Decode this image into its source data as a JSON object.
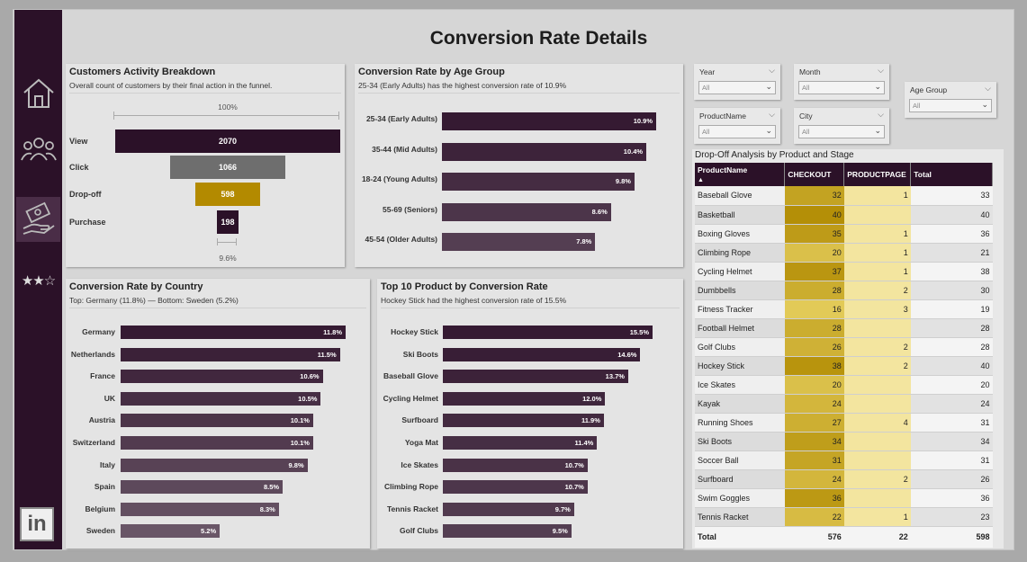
{
  "title": "Conversion Rate Details",
  "colors": {
    "dark": "#2b1128",
    "bar1": "#3a2037",
    "bar2": "#4a3448",
    "bar3": "#5a4559",
    "gold": "#b38a00",
    "gray": "#6e6e6e"
  },
  "nav": {
    "items": [
      "home-icon",
      "customers-icon",
      "conversion-icon",
      "rating-icon"
    ],
    "rating": "★★☆",
    "linkedin": "in"
  },
  "funnel": {
    "title": "Customers Activity Breakdown",
    "subtitle": "Overall count of customers by their final action in the funnel.",
    "top_pct": "100%",
    "bottom_pct": "9.6%",
    "stages": [
      {
        "label": "View",
        "value": 2070,
        "value_label": "2070",
        "color": "#2b1128"
      },
      {
        "label": "Click",
        "value": 1066,
        "value_label": "1066",
        "color": "#6e6e6e"
      },
      {
        "label": "Drop-off",
        "value": 598,
        "value_label": "598",
        "color": "#b38a00"
      },
      {
        "label": "Purchase",
        "value": 198,
        "value_label": "198",
        "color": "#2b1128"
      }
    ]
  },
  "age": {
    "title": "Conversion Rate by Age Group",
    "subtitle": "25-34 (Early Adults) has the highest conversion rate of 10.9%",
    "max": 10.9,
    "items": [
      {
        "label": "25-34 (Early Adults)",
        "value": 10.9,
        "value_label": "10.9%"
      },
      {
        "label": "35-44 (Mid Adults)",
        "value": 10.4,
        "value_label": "10.4%"
      },
      {
        "label": "18-24 (Young Adults)",
        "value": 9.8,
        "value_label": "9.8%"
      },
      {
        "label": "55-69 (Seniors)",
        "value": 8.6,
        "value_label": "8.6%"
      },
      {
        "label": "45-54 (Older Adults)",
        "value": 7.8,
        "value_label": "7.8%"
      }
    ]
  },
  "country": {
    "title": "Conversion Rate by Country",
    "subtitle": "Top: Germany (11.8%) — Bottom: Sweden (5.2%)",
    "max": 11.8,
    "items": [
      {
        "label": "Germany",
        "value": 11.8,
        "value_label": "11.8%"
      },
      {
        "label": "Netherlands",
        "value": 11.5,
        "value_label": "11.5%"
      },
      {
        "label": "France",
        "value": 10.6,
        "value_label": "10.6%"
      },
      {
        "label": "UK",
        "value": 10.5,
        "value_label": "10.5%"
      },
      {
        "label": "Austria",
        "value": 10.1,
        "value_label": "10.1%"
      },
      {
        "label": "Switzerland",
        "value": 10.1,
        "value_label": "10.1%"
      },
      {
        "label": "Italy",
        "value": 9.8,
        "value_label": "9.8%"
      },
      {
        "label": "Spain",
        "value": 8.5,
        "value_label": "8.5%"
      },
      {
        "label": "Belgium",
        "value": 8.3,
        "value_label": "8.3%"
      },
      {
        "label": "Sweden",
        "value": 5.2,
        "value_label": "5.2%"
      }
    ]
  },
  "product": {
    "title": "Top 10 Product by Conversion Rate",
    "subtitle": "Hockey Stick had the highest conversion rate of 15.5%",
    "max": 15.5,
    "items": [
      {
        "label": "Hockey Stick",
        "value": 15.5,
        "value_label": "15.5%"
      },
      {
        "label": "Ski Boots",
        "value": 14.6,
        "value_label": "14.6%"
      },
      {
        "label": "Baseball Glove",
        "value": 13.7,
        "value_label": "13.7%"
      },
      {
        "label": "Cycling Helmet",
        "value": 12.0,
        "value_label": "12.0%"
      },
      {
        "label": "Surfboard",
        "value": 11.9,
        "value_label": "11.9%"
      },
      {
        "label": "Yoga Mat",
        "value": 11.4,
        "value_label": "11.4%"
      },
      {
        "label": "Ice Skates",
        "value": 10.7,
        "value_label": "10.7%"
      },
      {
        "label": "Climbing Rope",
        "value": 10.7,
        "value_label": "10.7%"
      },
      {
        "label": "Tennis Racket",
        "value": 9.7,
        "value_label": "9.7%"
      },
      {
        "label": "Golf Clubs",
        "value": 9.5,
        "value_label": "9.5%"
      }
    ]
  },
  "slicers": {
    "year": {
      "label": "Year",
      "value": "All"
    },
    "month": {
      "label": "Month",
      "value": "All"
    },
    "age_group": {
      "label": "Age Group",
      "value": "All"
    },
    "product_name": {
      "label": "ProductName",
      "value": "All"
    },
    "city": {
      "label": "City",
      "value": "All"
    }
  },
  "dropoff": {
    "title": "Drop-Off Analysis by Product and Stage",
    "columns": [
      "ProductName",
      "CHECKOUT",
      "PRODUCTPAGE",
      "Total"
    ],
    "sort_indicator": "▲",
    "rows": [
      {
        "name": "Baseball Glove",
        "checkout": 32,
        "productpage": "1",
        "total": 33
      },
      {
        "name": "Basketball",
        "checkout": 40,
        "productpage": "",
        "total": 40
      },
      {
        "name": "Boxing Gloves",
        "checkout": 35,
        "productpage": "1",
        "total": 36
      },
      {
        "name": "Climbing Rope",
        "checkout": 20,
        "productpage": "1",
        "total": 21
      },
      {
        "name": "Cycling Helmet",
        "checkout": 37,
        "productpage": "1",
        "total": 38
      },
      {
        "name": "Dumbbells",
        "checkout": 28,
        "productpage": "2",
        "total": 30
      },
      {
        "name": "Fitness Tracker",
        "checkout": 16,
        "productpage": "3",
        "total": 19
      },
      {
        "name": "Football Helmet",
        "checkout": 28,
        "productpage": "",
        "total": 28
      },
      {
        "name": "Golf Clubs",
        "checkout": 26,
        "productpage": "2",
        "total": 28
      },
      {
        "name": "Hockey Stick",
        "checkout": 38,
        "productpage": "2",
        "total": 40
      },
      {
        "name": "Ice Skates",
        "checkout": 20,
        "productpage": "",
        "total": 20
      },
      {
        "name": "Kayak",
        "checkout": 24,
        "productpage": "",
        "total": 24
      },
      {
        "name": "Running Shoes",
        "checkout": 27,
        "productpage": "4",
        "total": 31
      },
      {
        "name": "Ski Boots",
        "checkout": 34,
        "productpage": "",
        "total": 34
      },
      {
        "name": "Soccer Ball",
        "checkout": 31,
        "productpage": "",
        "total": 31
      },
      {
        "name": "Surfboard",
        "checkout": 24,
        "productpage": "2",
        "total": 26
      },
      {
        "name": "Swim Goggles",
        "checkout": 36,
        "productpage": "",
        "total": 36
      },
      {
        "name": "Tennis Racket",
        "checkout": 22,
        "productpage": "1",
        "total": 23
      }
    ],
    "total": {
      "label": "Total",
      "checkout": 576,
      "productpage": 22,
      "total": 598
    }
  }
}
